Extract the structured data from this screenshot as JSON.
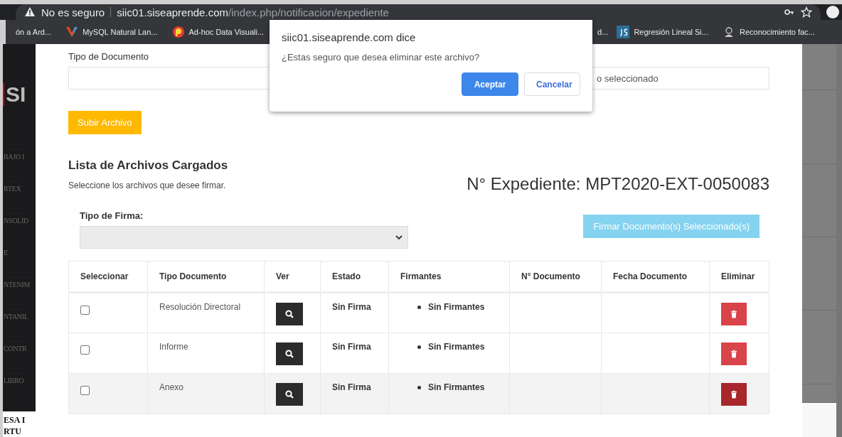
{
  "browser": {
    "security": "No es seguro",
    "url_host": "siic01.siseaprende.com",
    "url_path": "/index.php/notificacion/expediente",
    "bookmarks": [
      {
        "label": "ón a Ard..."
      },
      {
        "label": "MySQL Natural Lan..."
      },
      {
        "label": "Ad-hoc Data Visuali..."
      },
      {
        "label": "d..."
      },
      {
        "label": "Regresión Lineal Si..."
      },
      {
        "label": "Reconocimiento fac..."
      }
    ]
  },
  "sidebar": {
    "logo": "SI",
    "items": [
      "BAJO I",
      "RTEX",
      "NSOLID",
      "E",
      "NTENIM",
      "NTANIL",
      "CONTR",
      "LIBRO"
    ],
    "footer": [
      "ESA I",
      "RTU"
    ]
  },
  "form": {
    "document_type_label": "Tipo de Documento",
    "file_status": "o seleccionado",
    "upload_button": "Subir Archivo"
  },
  "list": {
    "title": "Lista de Archivos Cargados",
    "subtitle": "Seleccione los archivos que desee firmar.",
    "expediente": "N° Expediente: MPT2020-EXT-0050083",
    "signature_label": "Tipo de Firma:",
    "sign_button": "Firmar Documento(s) Seleccionado(s)"
  },
  "table": {
    "columns": [
      "Seleccionar",
      "Tipo Documento",
      "Ver",
      "Estado",
      "Firmantes",
      "N° Documento",
      "Fecha Documento",
      "Eliminar"
    ],
    "rows": [
      {
        "checked": false,
        "highlighted": false,
        "tipo": "Resolución Directoral",
        "estado": "Sin Firma",
        "firmantes": [
          "Sin Firmantes"
        ]
      },
      {
        "checked": false,
        "highlighted": false,
        "tipo": "Informe",
        "estado": "Sin Firma",
        "firmantes": [
          "Sin Firmantes"
        ]
      },
      {
        "checked": false,
        "highlighted": true,
        "tipo": "Anexo",
        "estado": "Sin Firma",
        "firmantes": [
          "Sin Firmantes"
        ]
      }
    ]
  },
  "dialog": {
    "title": "siic01.siseaprende.com dice",
    "message": "¿Estas seguro que desea eliminar este archivo?",
    "buttons": [
      {
        "label": "Aceptar",
        "kind": "primary"
      },
      {
        "label": "Cancelar",
        "kind": "secondary"
      }
    ]
  }
}
